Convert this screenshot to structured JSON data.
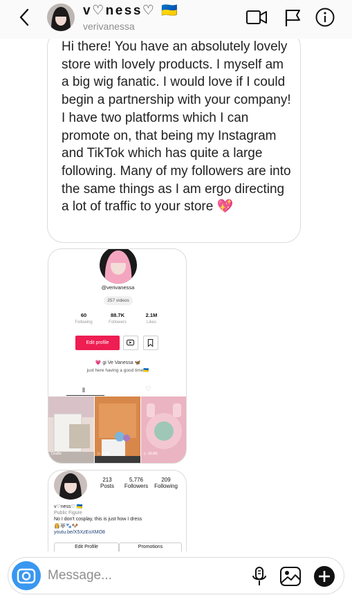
{
  "header": {
    "name": "v♡ness♡ 🇺🇦",
    "username": "verivanessa",
    "icons": [
      "back-chevron-icon",
      "video-call-icon",
      "flag-icon",
      "info-icon"
    ]
  },
  "message": {
    "text": "Hi there! You have an absolutely lovely store with lovely products. I myself am a big wig fanatic. I would love if I could begin a partnership with your company! I have two platforms which I can promote on, that being my Instagram and TikTok which has quite a large following. Many of my followers are into the same things as I am ergo directing a lot of traffic to your store 💖"
  },
  "tiktok_screenshot": {
    "handle": "@verivanessa",
    "videos": "257 videos",
    "stats": [
      {
        "value": "60",
        "label": "Following"
      },
      {
        "value": "88.7K",
        "label": "Followers"
      },
      {
        "value": "2.1M",
        "label": "Likes"
      }
    ],
    "edit_label": "Edit profile",
    "bio_line1": "💗 gi Ve Vanessa 🦋",
    "bio_line2": "just here having a good time🇺🇦",
    "thumbnails": [
      {
        "label": "Drafts"
      },
      {
        "label": "▷ 4.5K"
      },
      {
        "label": "▷ 30.8K"
      }
    ]
  },
  "instagram_screenshot": {
    "stats": [
      {
        "value": "213",
        "label": "Posts"
      },
      {
        "value": "5,776",
        "label": "Followers"
      },
      {
        "value": "209",
        "label": "Following"
      }
    ],
    "name": "v♡ness♡ 🇺🇦",
    "category": "Public Figure",
    "bio": "No I don't cosplay, this is just how I dress",
    "emojis": "👸🐺🐾🐶",
    "link": "youtu.be/X5XzEoXMO8",
    "edit_label": "Edit Profile",
    "promotions_label": "Promotions"
  },
  "composer": {
    "placeholder": "Message..."
  },
  "colors": {
    "accent_blue": "#3897f0",
    "tiktok_red": "#ee1d52",
    "muted_text": "#8e8e8e",
    "border": "#dbdbdb"
  }
}
